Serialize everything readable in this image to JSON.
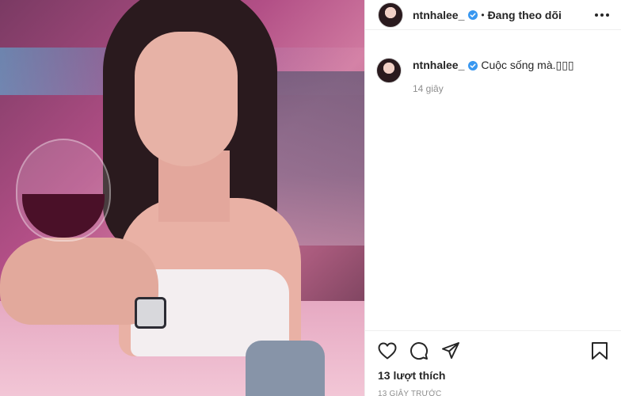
{
  "post": {
    "username": "ntnhalee_",
    "follow_status": "Đang theo dõi",
    "caption": "Cuộc sống mà.▯▯▯",
    "caption_time": "14 giây",
    "likes": "13 lượt thích",
    "post_time": "13 GIÂY TRƯỚC"
  },
  "icons": {
    "verified": "verified-badge-icon",
    "more": "more-options-icon",
    "like": "heart-icon",
    "comment": "comment-icon",
    "share": "share-icon",
    "save": "bookmark-icon"
  },
  "colors": {
    "verified_blue": "#3897f0",
    "text": "#262626",
    "muted": "#8e8e8e"
  }
}
